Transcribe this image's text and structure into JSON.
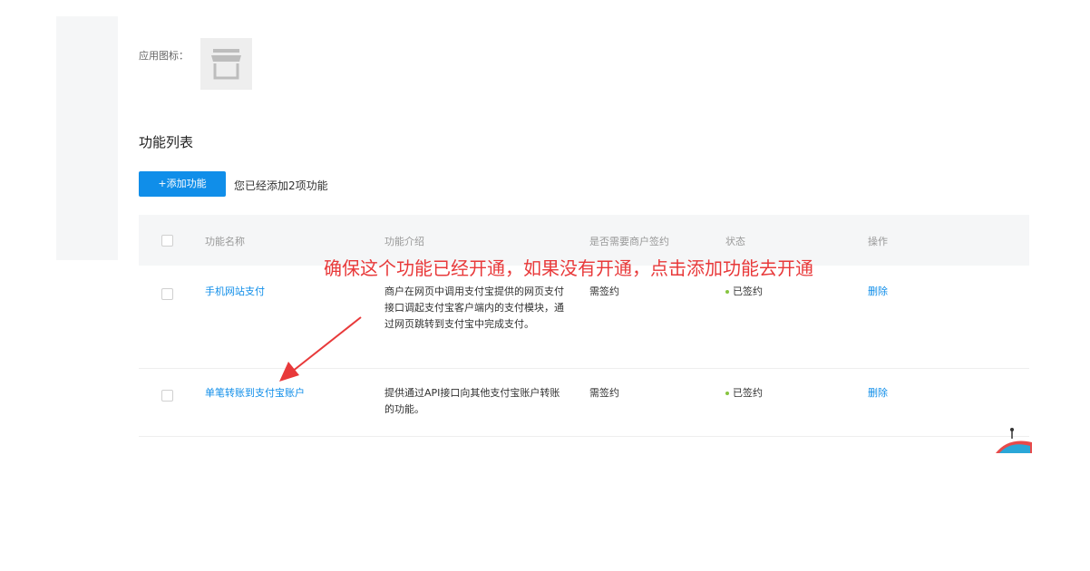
{
  "app_icon_label": "应用图标：",
  "section_title": "功能列表",
  "add_button_label": "+添加功能",
  "added_count_text": "您已经添加2项功能",
  "table": {
    "headers": {
      "name": "功能名称",
      "intro": "功能介绍",
      "sign_required": "是否需要商户签约",
      "status": "状态",
      "action": "操作"
    },
    "rows": [
      {
        "name": "手机网站支付",
        "intro": "商户在网页中调用支付宝提供的网页支付接口调起支付宝客户端内的支付模块，通过网页跳转到支付宝中完成支付。",
        "sign_required": "需签约",
        "status": "已签约",
        "action": "删除"
      },
      {
        "name": "单笔转账到支付宝账户",
        "intro": "提供通过API接口向其他支付宝账户转账的功能。",
        "sign_required": "需签约",
        "status": "已签约",
        "action": "删除"
      }
    ]
  },
  "annotation_text": "确保这个功能已经开通，如果没有开通，点击添加功能去开通",
  "colors": {
    "accent": "#108ee9",
    "annotation": "#e8393a",
    "status_ok": "#87c440"
  }
}
